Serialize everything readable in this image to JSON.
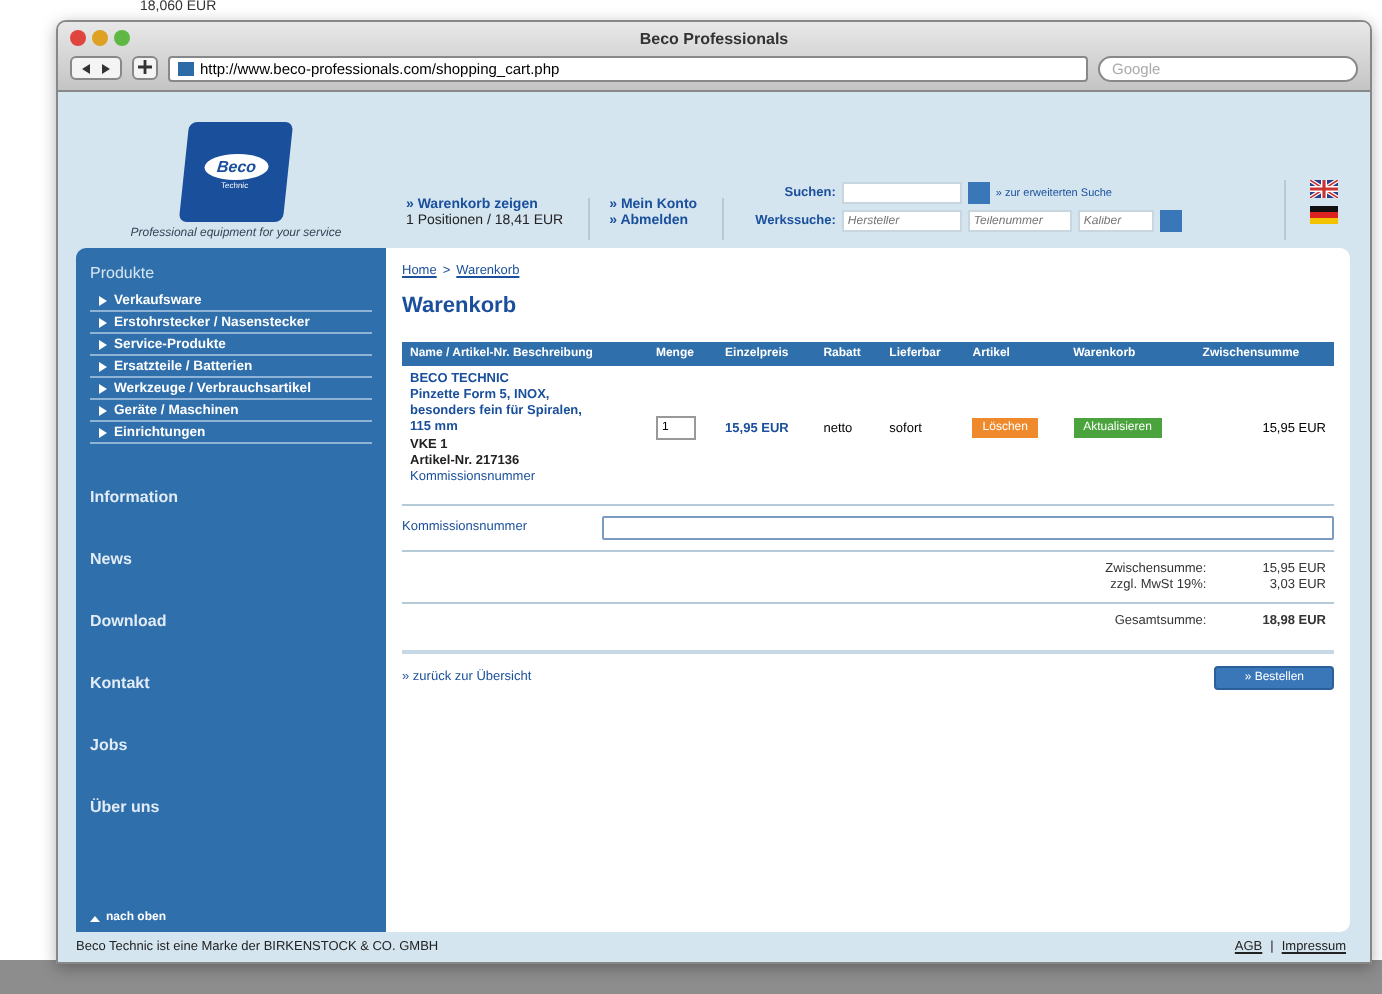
{
  "background_note": "18,060 EUR",
  "window": {
    "title": "Beco Professionals",
    "url": "http://www.beco-professionals.com/shopping_cart.php",
    "search_placeholder": "Google"
  },
  "header": {
    "tagline": "Professional equipment for your service",
    "logo_text": "Beco",
    "logo_sub": "Technic",
    "cart_link": "» Warenkorb zeigen",
    "cart_summary": "1 Positionen / 18,41 EUR",
    "account_links": [
      "» Mein Konto",
      "» Abmelden"
    ],
    "search_label": "Suchen:",
    "advanced_search": "» zur erweiterten Suche",
    "tool_search_label": "Werkssuche:",
    "tool_fields": [
      {
        "placeholder": "Hersteller"
      },
      {
        "placeholder": "Teilenummer"
      },
      {
        "placeholder": "Kaliber"
      }
    ]
  },
  "sidebar": {
    "section": "Produkte",
    "items": [
      "Verkaufsware",
      "Erstohrstecker / Nasenstecker",
      "Service-Produkte",
      "Ersatzteile / Batterien",
      "Werkzeuge / Verbrauchsartikel",
      "Geräte / Maschinen",
      "Einrichtungen"
    ],
    "links": [
      "Information",
      "News",
      "Download",
      "Kontakt",
      "Jobs",
      "Über uns"
    ],
    "to_top": "nach oben"
  },
  "breadcrumb": [
    "Home",
    "Warenkorb"
  ],
  "breadcrumb_separator": ">",
  "heading": "Warenkorb",
  "table": {
    "columns": [
      "Name / Artikel-Nr. Beschreibung",
      "Menge",
      "Einzelpreis",
      "Rabatt",
      "Lieferbar",
      "Artikel",
      "Warenkorb",
      "Zwischensumme"
    ],
    "rows": [
      {
        "lines": [
          "BECO TECHNIC",
          "Pinzette Form 5, INOX, besonders fein für Spiralen, 115 mm",
          "VKE 1",
          "Artikel-Nr. 217136",
          "Kommissionsnummer"
        ],
        "quantity": "1",
        "price": "15,95 EUR",
        "discount": "netto",
        "availability": "sofort",
        "delete": "Löschen",
        "update": "Aktualisieren",
        "subtotal": "15,95 EUR"
      }
    ]
  },
  "commission_label": "Kommissionsnummer",
  "totals": [
    {
      "label": "Zwischensumme:",
      "value": "15,95 EUR"
    },
    {
      "label": "zzgl. MwSt 19%:",
      "value": "3,03 EUR"
    }
  ],
  "grand_total": {
    "label": "Gesamtsumme:",
    "value": "18,98 EUR"
  },
  "back_link": "» zurück zur Übersicht",
  "order_button": "» Bestellen",
  "footer": {
    "text": "Beco Technic ist eine Marke der BIRKENSTOCK & CO. GMBH",
    "links": [
      "AGB",
      "Impressum"
    ],
    "separator": "|"
  }
}
